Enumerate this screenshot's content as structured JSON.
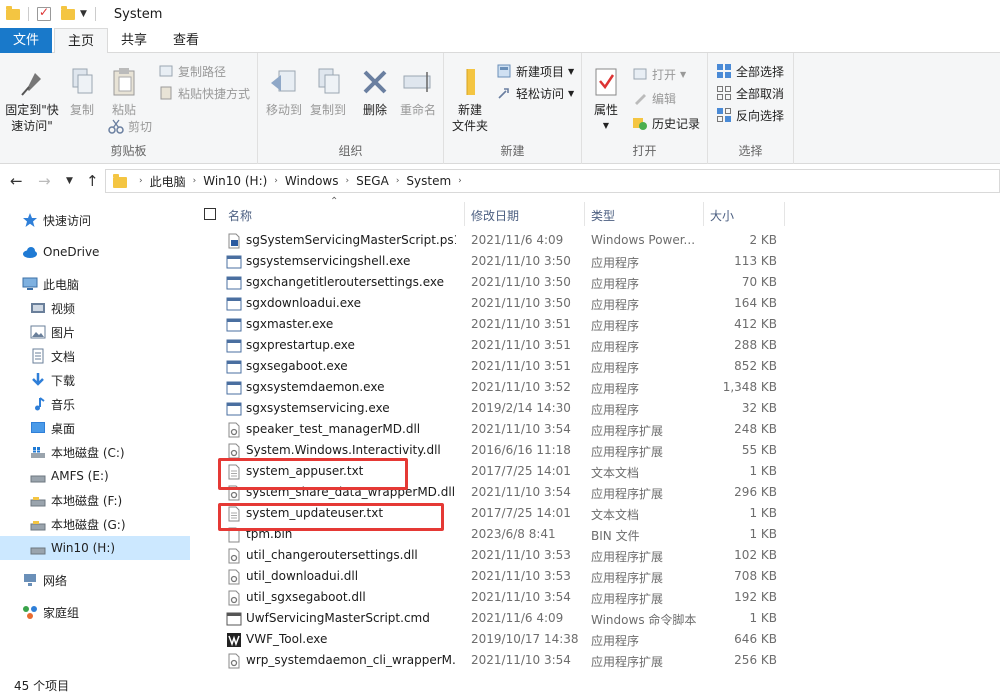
{
  "window": {
    "title": "System"
  },
  "tabs": [
    "文件",
    "主页",
    "共享",
    "查看"
  ],
  "ribbon": {
    "clipboard": {
      "label": "剪贴板",
      "pin": "固定到\"快\n速访问\"",
      "copy": "复制",
      "paste": "粘贴",
      "copy_path": "复制路径",
      "paste_shortcut": "粘贴快捷方式",
      "cut": "剪切"
    },
    "organize": {
      "label": "组织",
      "move_to": "移动到",
      "copy_to": "复制到",
      "delete": "删除",
      "rename": "重命名"
    },
    "new": {
      "label": "新建",
      "new_item": "新建项目",
      "easy_access": "轻松访问",
      "new_folder": "新建\n文件夹"
    },
    "open": {
      "label": "打开",
      "properties": "属性",
      "open": "打开",
      "edit": "编辑",
      "history": "历史记录"
    },
    "select": {
      "label": "选择",
      "select_all": "全部选择",
      "select_none": "全部取消",
      "invert": "反向选择"
    }
  },
  "address": {
    "crumbs": [
      "此电脑",
      "Win10 (H:)",
      "Windows",
      "SEGA",
      "System"
    ]
  },
  "nav": {
    "quick_access": "快速访问",
    "onedrive": "OneDrive",
    "this_pc": "此电脑",
    "videos": "视频",
    "pictures": "图片",
    "documents": "文档",
    "downloads": "下载",
    "music": "音乐",
    "desktop": "桌面",
    "drive_c": "本地磁盘 (C:)",
    "drive_e": "AMFS (E:)",
    "drive_f": "本地磁盘 (F:)",
    "drive_g": "本地磁盘 (G:)",
    "drive_h": "Win10 (H:)",
    "network": "网络",
    "homegroup": "家庭组"
  },
  "columns": {
    "name": "名称",
    "date": "修改日期",
    "type": "类型",
    "size": "大小"
  },
  "files": [
    {
      "name": "sgSystemServicingMasterScript.ps1",
      "date": "2021/11/6 4:09",
      "type": "Windows Power...",
      "size": "2 KB",
      "icon": "ps1"
    },
    {
      "name": "sgsystemservicingshell.exe",
      "date": "2021/11/10 3:50",
      "type": "应用程序",
      "size": "113 KB",
      "icon": "exe"
    },
    {
      "name": "sgxchangetitleroutersettings.exe",
      "date": "2021/11/10 3:50",
      "type": "应用程序",
      "size": "70 KB",
      "icon": "exe"
    },
    {
      "name": "sgxdownloadui.exe",
      "date": "2021/11/10 3:50",
      "type": "应用程序",
      "size": "164 KB",
      "icon": "exe"
    },
    {
      "name": "sgxmaster.exe",
      "date": "2021/11/10 3:51",
      "type": "应用程序",
      "size": "412 KB",
      "icon": "exe"
    },
    {
      "name": "sgxprestartup.exe",
      "date": "2021/11/10 3:51",
      "type": "应用程序",
      "size": "288 KB",
      "icon": "exe"
    },
    {
      "name": "sgxsegaboot.exe",
      "date": "2021/11/10 3:51",
      "type": "应用程序",
      "size": "852 KB",
      "icon": "exe"
    },
    {
      "name": "sgxsystemdaemon.exe",
      "date": "2021/11/10 3:52",
      "type": "应用程序",
      "size": "1,348 KB",
      "icon": "exe"
    },
    {
      "name": "sgxsystemservicing.exe",
      "date": "2019/2/14 14:30",
      "type": "应用程序",
      "size": "32 KB",
      "icon": "exe"
    },
    {
      "name": "speaker_test_managerMD.dll",
      "date": "2021/11/10 3:54",
      "type": "应用程序扩展",
      "size": "248 KB",
      "icon": "dll"
    },
    {
      "name": "System.Windows.Interactivity.dll",
      "date": "2016/6/16 11:18",
      "type": "应用程序扩展",
      "size": "55 KB",
      "icon": "dll"
    },
    {
      "name": "system_appuser.txt",
      "date": "2017/7/25 14:01",
      "type": "文本文档",
      "size": "1 KB",
      "icon": "txt"
    },
    {
      "name": "system_share_data_wrapperMD.dll",
      "date": "2021/11/10 3:54",
      "type": "应用程序扩展",
      "size": "296 KB",
      "icon": "dll"
    },
    {
      "name": "system_updateuser.txt",
      "date": "2017/7/25 14:01",
      "type": "文本文档",
      "size": "1 KB",
      "icon": "txt"
    },
    {
      "name": "tpm.bin",
      "date": "2023/6/8 8:41",
      "type": "BIN 文件",
      "size": "1 KB",
      "icon": "bin"
    },
    {
      "name": "util_changeroutersettings.dll",
      "date": "2021/11/10 3:53",
      "type": "应用程序扩展",
      "size": "102 KB",
      "icon": "dll"
    },
    {
      "name": "util_downloadui.dll",
      "date": "2021/11/10 3:53",
      "type": "应用程序扩展",
      "size": "708 KB",
      "icon": "dll"
    },
    {
      "name": "util_sgxsegaboot.dll",
      "date": "2021/11/10 3:54",
      "type": "应用程序扩展",
      "size": "192 KB",
      "icon": "dll"
    },
    {
      "name": "UwfServicingMasterScript.cmd",
      "date": "2021/11/6 4:09",
      "type": "Windows 命令脚本",
      "size": "1 KB",
      "icon": "cmd"
    },
    {
      "name": "VWF_Tool.exe",
      "date": "2019/10/17 14:38",
      "type": "应用程序",
      "size": "646 KB",
      "icon": "vwf"
    },
    {
      "name": "wrp_systemdaemon_cli_wrapperM...",
      "date": "2021/11/10 3:54",
      "type": "应用程序扩展",
      "size": "256 KB",
      "icon": "dll"
    }
  ],
  "status": {
    "count": "45 个项目"
  }
}
